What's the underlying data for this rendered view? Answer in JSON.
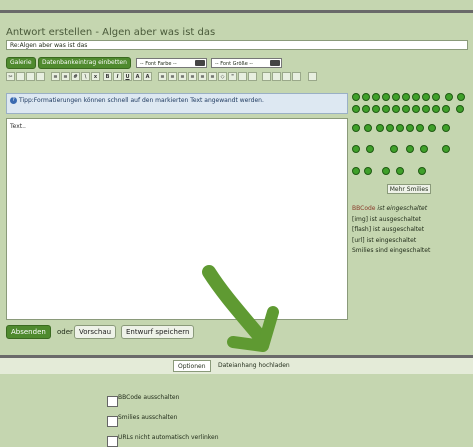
{
  "title": "Antwort erstellen - Algen aber was ist das",
  "subject_value": "Re:Algen aber was ist das",
  "buttons": {
    "gallery": "Galerie",
    "db_insert": "Datenbankeintrag einbetten"
  },
  "selects": {
    "font_color": "-- Font Farbe --",
    "font_size": "-- Font Größe --"
  },
  "tip": "Tipp:Formatierungen können schnell auf den markierten Text angewandt werden.",
  "editor_text": "Text..",
  "toolbar_icons": [
    "cut",
    "copy",
    "paste",
    "paste-text",
    "list-ul",
    "list-ol",
    "anchor",
    "hr",
    "bold",
    "italic",
    "underline",
    "superscript",
    "subscript",
    "align-left",
    "align-center",
    "align-right",
    "align-justify",
    "indent",
    "outdent",
    "code",
    "quote",
    "image",
    "link",
    "unlink",
    "email",
    "search",
    "save"
  ],
  "more_smilies": "Mehr Smilies",
  "status": {
    "bbcode_hl": "BBCode",
    "bbcode_rest": " ist eingeschaltet",
    "img": "[img] ist ausgeschaltet",
    "flash": "[flash] ist ausgeschaltet",
    "url": "[url] ist eingeschaltet",
    "smilies": "Smilies sind eingeschaltet"
  },
  "actions": {
    "send": "Absenden",
    "or": "oder",
    "preview": "Vorschau",
    "draft": "Entwurf speichern"
  },
  "tabs": {
    "options": "Optionen",
    "attachment": "Dateianhang hochladen"
  },
  "options": {
    "bbcode_off": "BBCode ausschalten",
    "smilies_off": "Smilies ausschalten",
    "urls_off": "URLs nicht automatisch verlinken"
  },
  "colors": {
    "bg": "#c5d6b0",
    "accent": "#4f8a2e",
    "arrow": "#5f9a32"
  }
}
